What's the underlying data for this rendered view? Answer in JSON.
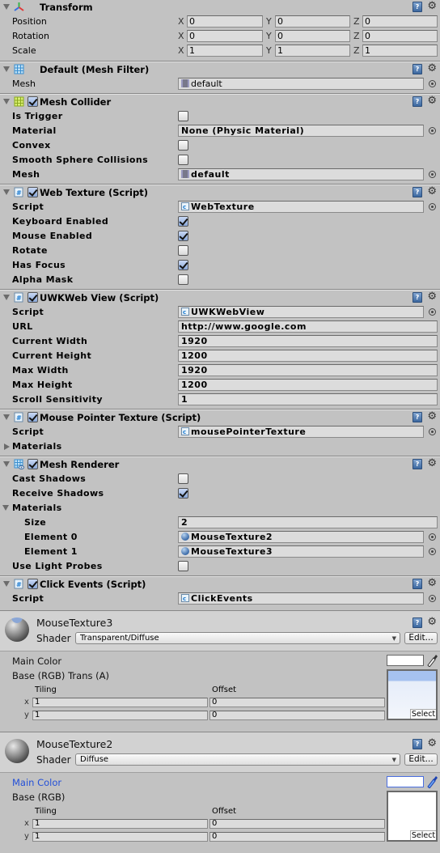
{
  "transform": {
    "title": "Transform",
    "rows": [
      {
        "label": "Position",
        "x": "0",
        "y": "0",
        "z": "0"
      },
      {
        "label": "Rotation",
        "x": "0",
        "y": "0",
        "z": "0"
      },
      {
        "label": "Scale",
        "x": "1",
        "y": "1",
        "z": "1"
      }
    ],
    "axis": {
      "x": "X",
      "y": "Y",
      "z": "Z"
    }
  },
  "mesh_filter": {
    "title": "Default (Mesh Filter)",
    "mesh_label": "Mesh",
    "mesh_value": "default"
  },
  "mesh_collider": {
    "title": "Mesh Collider",
    "enabled": true,
    "is_trigger_label": "Is Trigger",
    "is_trigger": false,
    "material_label": "Material",
    "material_value": "None (Physic Material)",
    "convex_label": "Convex",
    "convex": false,
    "smooth_label": "Smooth Sphere Collisions",
    "smooth": false,
    "mesh_label": "Mesh",
    "mesh_value": "default"
  },
  "web_texture": {
    "title": "Web Texture (Script)",
    "enabled": true,
    "script_label": "Script",
    "script_value": "WebTexture",
    "keyboard_label": "Keyboard Enabled",
    "keyboard": true,
    "mouse_label": "Mouse Enabled",
    "mouse": true,
    "rotate_label": "Rotate",
    "rotate": false,
    "focus_label": "Has Focus",
    "focus": true,
    "alpha_label": "Alpha Mask",
    "alpha": false
  },
  "uwk_web_view": {
    "title": "UWKWeb View (Script)",
    "enabled": true,
    "script_label": "Script",
    "script_value": "UWKWebView",
    "url_label": "URL",
    "url_value": "http://www.google.com",
    "cur_width_label": "Current Width",
    "cur_width": "1920",
    "cur_height_label": "Current Height",
    "cur_height": "1200",
    "max_width_label": "Max Width",
    "max_width": "1920",
    "max_height_label": "Max Height",
    "max_height": "1200",
    "scroll_label": "Scroll Sensitivity",
    "scroll": "1"
  },
  "mouse_pointer": {
    "title": "Mouse Pointer Texture (Script)",
    "enabled": true,
    "script_label": "Script",
    "script_value": "mousePointerTexture",
    "materials_label": "Materials"
  },
  "mesh_renderer": {
    "title": "Mesh Renderer",
    "enabled": true,
    "cast_label": "Cast Shadows",
    "cast": false,
    "receive_label": "Receive Shadows",
    "receive": true,
    "materials_label": "Materials",
    "size_label": "Size",
    "size": "2",
    "elements": [
      {
        "label": "Element 0",
        "value": "MouseTexture2"
      },
      {
        "label": "Element 1",
        "value": "MouseTexture3"
      }
    ],
    "probes_label": "Use Light Probes",
    "probes": false
  },
  "click_events": {
    "title": "Click Events (Script)",
    "enabled": true,
    "script_label": "Script",
    "script_value": "ClickEvents"
  },
  "materials": [
    {
      "name": "MouseTexture3",
      "shader_label": "Shader",
      "shader": "Transparent/Diffuse",
      "edit_label": "Edit...",
      "main_color_label": "Main Color",
      "base_label": "Base (RGB) Trans (A)",
      "tiling_label": "Tiling",
      "offset_label": "Offset",
      "x_label": "x",
      "y_label": "y",
      "tiling_x": "1",
      "tiling_y": "1",
      "offset_x": "0",
      "offset_y": "0",
      "select_label": "Select",
      "main_color": "#ffffff"
    },
    {
      "name": "MouseTexture2",
      "shader_label": "Shader",
      "shader": "Diffuse",
      "edit_label": "Edit...",
      "main_color_label": "Main Color",
      "base_label": "Base (RGB)",
      "tiling_label": "Tiling",
      "offset_label": "Offset",
      "x_label": "x",
      "y_label": "y",
      "tiling_x": "1",
      "tiling_y": "1",
      "offset_x": "0",
      "offset_y": "0",
      "select_label": "Select",
      "main_color": "#ffffff"
    }
  ],
  "icons": {
    "help": "?",
    "gear": "⚙"
  }
}
